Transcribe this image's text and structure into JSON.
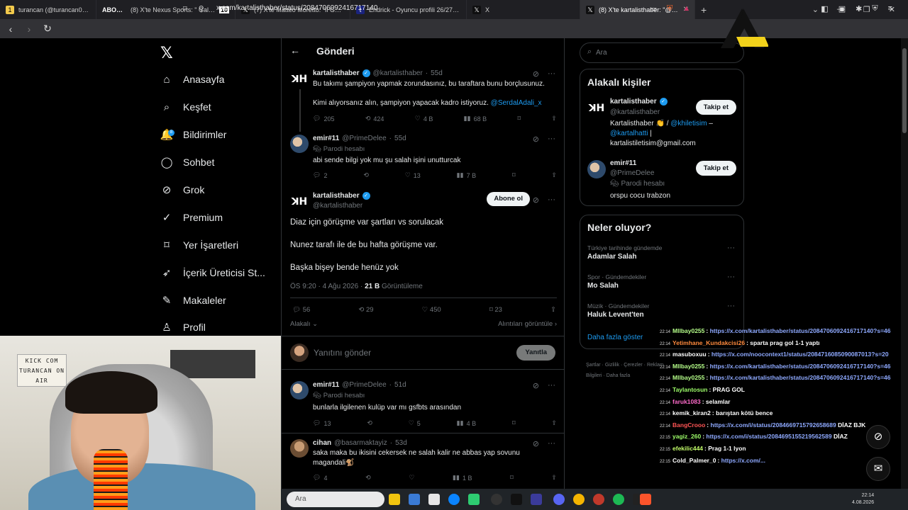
{
  "browser": {
    "tabs": [
      {
        "title": "turancan (@turancan0) / X",
        "badge": "",
        "active": false
      },
      {
        "title": "(8) X'te Nexus Sports: \" Galatasara",
        "prefix": "ABONE...",
        "badge": "10",
        "active": false
      },
      {
        "title": "(7) X'te Matteo Moretto: \"Il Galatasar",
        "badge": "",
        "active": false
      },
      {
        "title": "Endrick - Oyuncu profili 26/27 | Trans",
        "badge": "",
        "active": false
      },
      {
        "title": "X",
        "badge": "",
        "active": false
      },
      {
        "title": "(8) X'te kartalisthaber: \"@PrimeD",
        "badge": "",
        "active": true
      }
    ],
    "url": "x.com/kartalisthaber/status/2084706092416717140"
  },
  "nav": {
    "items": [
      {
        "label": "Anasayfa",
        "icon": "home-icon",
        "glyph": "⌂"
      },
      {
        "label": "Keşfet",
        "icon": "search-icon",
        "glyph": "⌕"
      },
      {
        "label": "Bildirimler",
        "icon": "bell-icon",
        "glyph": "🔔",
        "badge": "8"
      },
      {
        "label": "Sohbet",
        "icon": "chat-icon",
        "glyph": "◯"
      },
      {
        "label": "Grok",
        "icon": "grok-icon",
        "glyph": "⊘"
      },
      {
        "label": "Premium",
        "icon": "premium-icon",
        "glyph": "✓"
      },
      {
        "label": "Yer İşaretleri",
        "icon": "bookmark-icon",
        "glyph": "⌑"
      },
      {
        "label": "İçerik Üreticisi St...",
        "icon": "rocket-icon",
        "glyph": "➶"
      },
      {
        "label": "Makaleler",
        "icon": "article-icon",
        "glyph": "✎"
      },
      {
        "label": "Profil",
        "icon": "profile-icon",
        "glyph": "♙"
      }
    ]
  },
  "main": {
    "title": "Gönderi",
    "parent_post": {
      "name": "kartalisthaber",
      "handle": "@kartalisthaber",
      "age": "55d",
      "line1": "Bu takımı şampiyon yapmak zorundasınız, bu taraftara bunu borçlusunuz.",
      "line2": "Kimi alıyorsanız alın, şampiyon yapacak kadro istiyoruz.",
      "mention": "@SerdalAdali_x",
      "replies": "205",
      "reposts": "424",
      "likes": "4 B",
      "views": "68 B"
    },
    "reply_1": {
      "name": "emir#11",
      "handle": "@PrimeDelee",
      "age": "55d",
      "parody": "Parodi hesabı",
      "text": "abi sende bilgi yok mu şu salah işini unutturcak",
      "replies": "2",
      "reposts": "",
      "likes": "13",
      "views": "7 B"
    },
    "focus_post": {
      "name": "kartalisthaber",
      "handle": "@kartalisthaber",
      "subscribe": "Abone ol",
      "lines": [
        "Diaz için görüşme var şartları vs sorulacak",
        "Nunez tarafı ile de bu hafta görüşme var.",
        "Başka bişey bende henüz yok"
      ],
      "time": "ÖS 9:20 · 4 Ağu 2026 · ",
      "views": "21 B",
      "views_label": " Görüntüleme",
      "replies": "56",
      "reposts": "29",
      "likes": "450",
      "bookmarks": "23",
      "relevant": "Alakalı",
      "quotes": "Alıntıları görüntüle"
    },
    "reply_box": {
      "placeholder": "Yanıtını gönder",
      "button": "Yanıtla"
    },
    "reply_2": {
      "name": "emir#11",
      "handle": "@PrimeDelee",
      "age": "51d",
      "parody": "Parodi hesabı",
      "text": "bunlarla ilgilenen kulüp var mı gsfbts arasından",
      "replies": "13",
      "reposts": "",
      "likes": "5",
      "views": "4 B"
    },
    "reply_3": {
      "name": "cihan",
      "handle": "@basarmaktayiz",
      "age": "53d",
      "text": "saka maka bu ikisini cekersek ne salah kalir ne abbas yap sovunu magandali🐒",
      "replies": "4",
      "reposts": "",
      "likes": "",
      "views": "1 B"
    }
  },
  "right": {
    "search_placeholder": "Ara",
    "related": {
      "title": "Alakalı kişiler",
      "people": [
        {
          "name": "kartalisthaber",
          "handle": "@kartalisthaber",
          "follow": "Takip et",
          "bio_a": "Kartalisthaber 👏 / ",
          "bio_m1": "@khiletisim",
          "bio_b": " – ",
          "bio_m2": "@kartalhatti",
          "bio_c": " | kartalistiletisim@gmail.com"
        },
        {
          "name": "emir#11",
          "handle": "@PrimeDelee",
          "follow": "Takip et",
          "parody": "Parodi hesabı",
          "bio": "orspu cocu trabzon"
        }
      ]
    },
    "trends": {
      "title": "Neler oluyor?",
      "items": [
        {
          "category": "Türkiye tarihinde gündemde",
          "name": "Adamlar Salah"
        },
        {
          "category": "Spor · Gündemdekiler",
          "name": "Mo Salah"
        },
        {
          "category": "Müzik · Gündemdekiler",
          "name": "Haluk Levent'ten"
        }
      ],
      "show_more": "Daha fazla göster"
    },
    "footer": "Şartlar · Gizlilik · Çerezler · Reklam Bilgileri · Daha fazla"
  },
  "webcam": {
    "sign": "KICK COM TURANCAN ON AIR"
  },
  "chat": [
    {
      "t": "22:14",
      "user": "Mllbay0255",
      "color": "#b6ff8a",
      "msg": "",
      "link": "https://x.com/kartalisthaber/status/2084706092416717140?s=46"
    },
    {
      "t": "22:14",
      "user": "Yetimhane_Kundakcisi26",
      "color": "#ff8a3d",
      "msg": "sparta prag gol 1-1 yaptı",
      "link": ""
    },
    {
      "t": "22:14",
      "user": "masuboxuu",
      "color": "#ffffff",
      "msg": "",
      "link": "https://x.com/noocontext1/status/2084716085090087013?s=20"
    },
    {
      "t": "22:14",
      "user": "Mllbay0255",
      "color": "#b6ff8a",
      "msg": "",
      "link": "https://x.com/kartalisthaber/status/2084706092416717140?s=46"
    },
    {
      "t": "22:14",
      "user": "Mllbay0255",
      "color": "#b6ff8a",
      "msg": "",
      "link": "https://x.com/kartalisthaber/status/2084706092416717140?s=46"
    },
    {
      "t": "22:14",
      "user": "Taylantosun",
      "color": "#9eff6a",
      "msg": "PRAG GOL",
      "link": ""
    },
    {
      "t": "22:14",
      "user": "faruk1083",
      "color": "#ff6bcb",
      "msg": "selamlar",
      "link": ""
    },
    {
      "t": "22:14",
      "user": "kemik_kiran2",
      "color": "#ffffff",
      "msg": "barıştan kötü bence",
      "link": ""
    },
    {
      "t": "22:14",
      "user": "BangCrooo",
      "color": "#ff5555",
      "msg": "DİAZ BJK",
      "link": "https://x.com/i/status/2084669715792658689"
    },
    {
      "t": "22:15",
      "user": "yagiz_260",
      "color": "#9eff6a",
      "msg": "DİAZ",
      "link": "https://x.com/i/status/2084695155219562589"
    },
    {
      "t": "22:15",
      "user": "efekilic444",
      "color": "#c4ff6a",
      "msg": "Prag 1-1 lyon",
      "link": ""
    },
    {
      "t": "22:15",
      "user": "Cold_Palmer_0",
      "color": "#ffffff",
      "msg": "",
      "link": "https://x.com/..."
    }
  ],
  "taskbar": {
    "search": "Ara",
    "time": "22:14",
    "date": "4.08.2026"
  },
  "colors": {
    "accent": "#1d9bf0",
    "bg": "#000000",
    "border": "#2f3336",
    "muted": "#71767b"
  }
}
